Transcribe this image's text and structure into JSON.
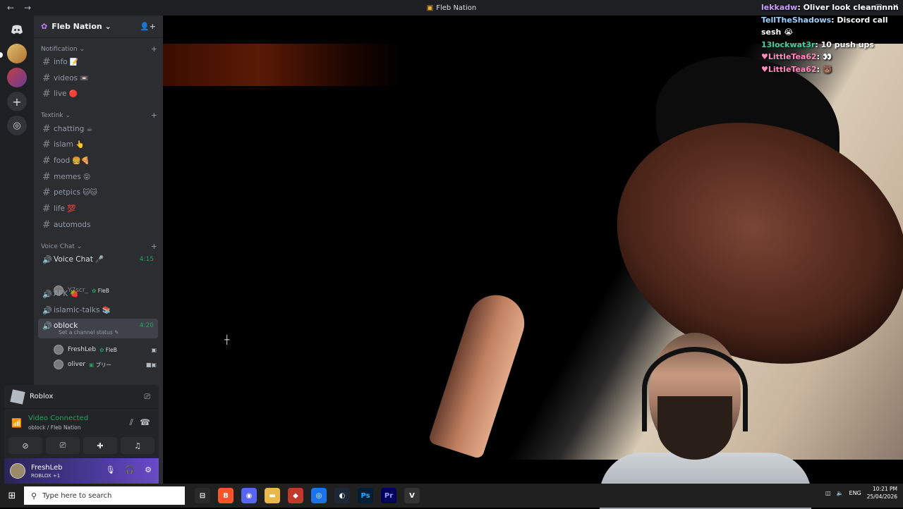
{
  "window": {
    "title": "Fleb Nation",
    "back": "←",
    "forward": "→"
  },
  "server": {
    "name": "Fleb Nation ⌄"
  },
  "categories": {
    "notification": "Notification ⌄",
    "textink": "Textink ⌄",
    "voice": "Voice Chat ⌄"
  },
  "channels": [
    {
      "name": "info",
      "emoji": "📝"
    },
    {
      "name": "videos",
      "emoji": "📼"
    },
    {
      "name": "live",
      "emoji": "🔴"
    },
    {
      "name": "chatting",
      "emoji": "☕"
    },
    {
      "name": "islam",
      "emoji": "👆"
    },
    {
      "name": "food",
      "emoji": "🍔🍕"
    },
    {
      "name": "memes",
      "emoji": "😝"
    },
    {
      "name": "petpics",
      "emoji": "🐱🐱"
    },
    {
      "name": "life",
      "emoji": "💯"
    },
    {
      "name": "automods",
      "emoji": ""
    }
  ],
  "voice_channels": [
    {
      "name": "Voice Chat",
      "emoji": "🎤",
      "time": "4:15"
    },
    {
      "name": "AFK",
      "emoji": "🍓",
      "time": ""
    },
    {
      "name": "islamic-talks",
      "emoji": "📚",
      "time": ""
    },
    {
      "name": "oblock",
      "emoji": "",
      "time": "4:20",
      "status": "Set a channel status ✎"
    }
  ],
  "voice_users": {
    "vc_user": {
      "name": "Y7scr_",
      "tag": "FleB"
    },
    "oblock_user1": {
      "name": "FreshLeb",
      "tag": "FleB"
    },
    "oblock_user2": {
      "name": "oliver",
      "tag": "ブリー"
    }
  },
  "activity": {
    "game": "Roblox"
  },
  "voice_connection": {
    "status": "Video Connected",
    "location": "oblock / Fleb Nation"
  },
  "me": {
    "name": "FreshLeb",
    "status": "ROBLOX +1"
  },
  "chat_overlay": [
    {
      "user": "lekkadw",
      "message": " Oliver look cleannnnn"
    },
    {
      "user": "TellTheShadows",
      "message": " Discord call sesh 😭"
    },
    {
      "user": "13lockwat3r",
      "message": " 10 push ups"
    },
    {
      "user": "LittleTea62",
      "message": " 👀"
    },
    {
      "user": "LittleTea62",
      "message": " 🐻"
    }
  ],
  "taskbar": {
    "search_placeholder": "Type here to search",
    "time": "10:21 PM",
    "date": "25/04/2026",
    "lang": "ENG"
  }
}
